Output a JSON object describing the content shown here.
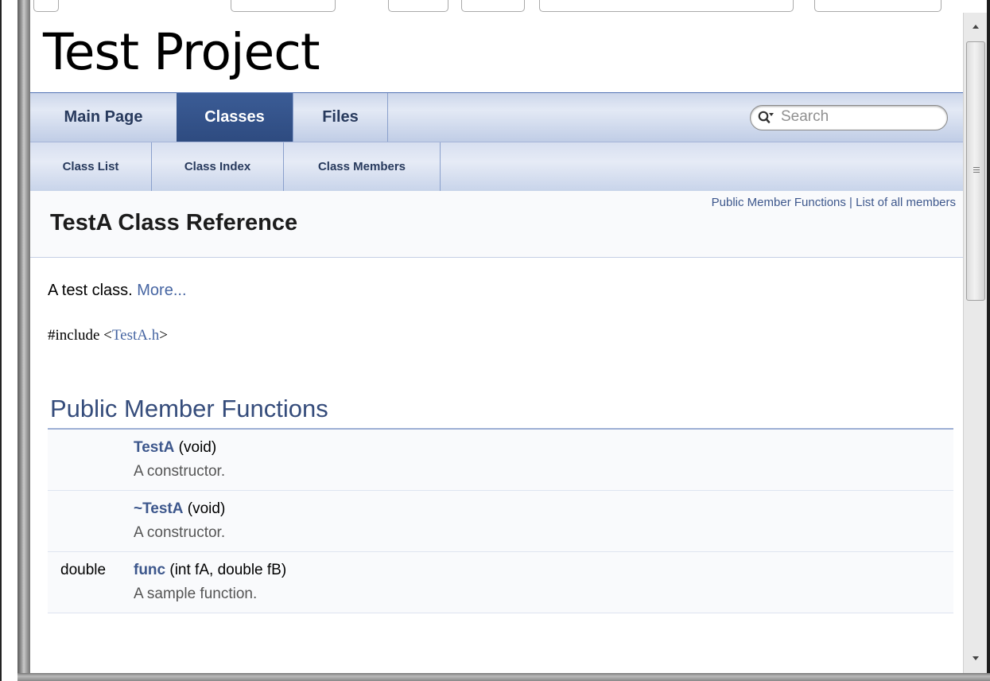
{
  "project": {
    "name": "Test Project"
  },
  "search": {
    "placeholder": "Search"
  },
  "tabs": {
    "main_page": "Main Page",
    "classes": "Classes",
    "files": "Files"
  },
  "subtabs": {
    "class_list": "Class List",
    "class_index": "Class Index",
    "class_members": "Class Members"
  },
  "header": {
    "summary_public_member_functions": "Public Member Functions",
    "summary_separator": " | ",
    "summary_list_of_all_members": "List of all members",
    "title": "TestA Class Reference"
  },
  "contents": {
    "brief_text": "A test class. ",
    "brief_more": "More...",
    "include_prefix": "#include <",
    "include_file": "TestA.h",
    "include_suffix": ">",
    "section_title": "Public Member Functions",
    "members": [
      {
        "type": "",
        "name": "TestA",
        "args": " (void)",
        "desc": "A constructor."
      },
      {
        "type": "",
        "name": "~TestA",
        "args": " (void)",
        "desc": "A constructor."
      },
      {
        "type": "double",
        "name": "func",
        "args": " (int fA, double fB)",
        "desc": "A sample function."
      }
    ]
  },
  "colors": {
    "link": "#3d578c",
    "tab_current_bg": "#2e4b80",
    "tab_text": "#283a5d",
    "section_title": "#354c7b"
  }
}
